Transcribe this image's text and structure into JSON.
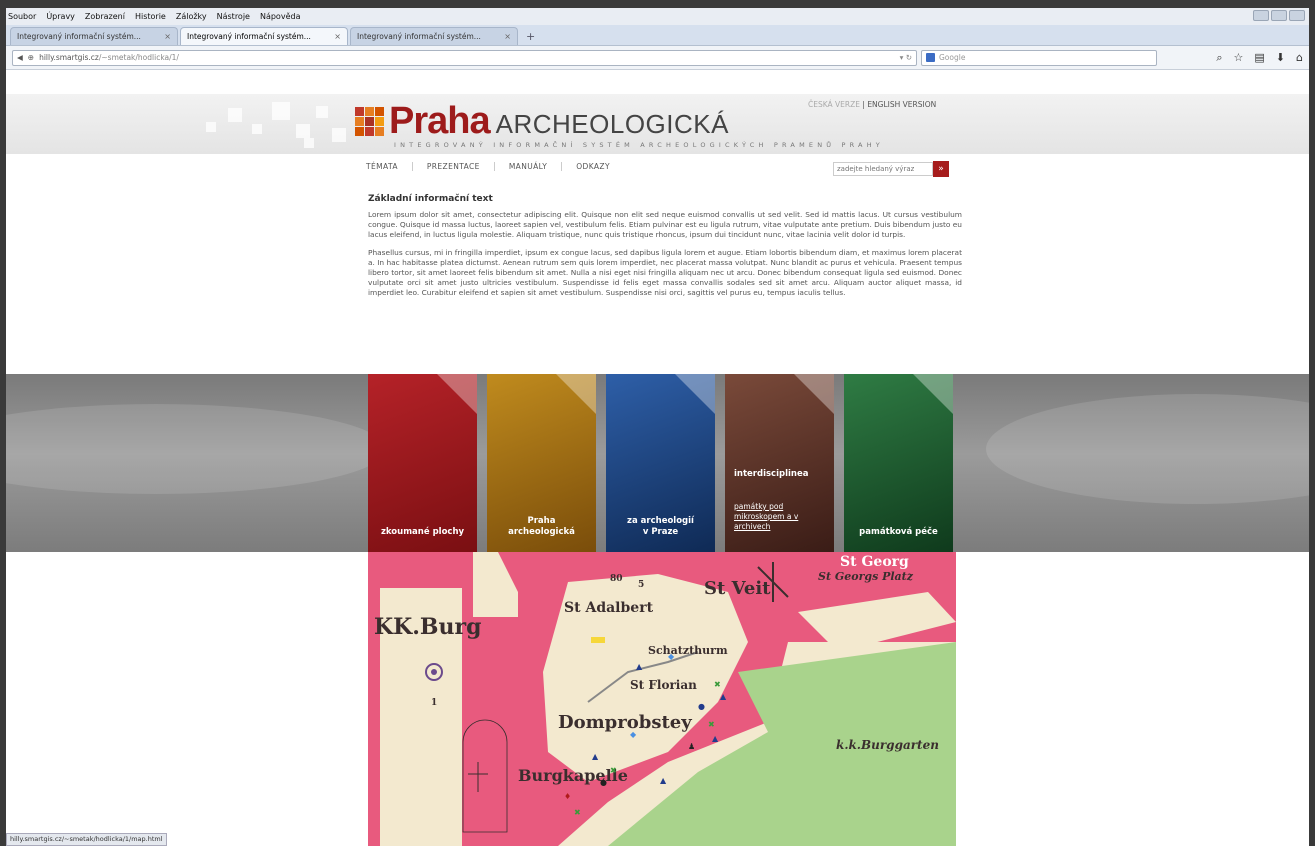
{
  "browser": {
    "menu": [
      "Soubor",
      "Úpravy",
      "Zobrazení",
      "Historie",
      "Záložky",
      "Nástroje",
      "Nápověda"
    ],
    "tabs": [
      {
        "label": "Integrovaný informační systém..."
      },
      {
        "label": "Integrovaný informační systém..."
      },
      {
        "label": "Integrovaný informační systém..."
      }
    ],
    "new_tab": "+",
    "url_host": "hilly.smartgis.cz",
    "url_path": "/~smetak/hodlicka/1/",
    "search_placeholder": "Google",
    "status_url": "hilly.smartgis.cz/~smetak/hodlicka/1/map.html"
  },
  "site": {
    "logo_praha": "Praha",
    "logo_arch": "ARCHEOLOGICKÁ",
    "tagline": "INTEGROVANÝ INFORMAČNÍ SYSTÉM ARCHEOLOGICKÝCH PRAMENŮ PRAHY",
    "lang_cz": "ČESKÁ VERZE",
    "lang_sep": "|",
    "lang_en": "ENGLISH VERSION",
    "nav": [
      "TÉMATA",
      "PREZENTACE",
      "MANUÁLY",
      "ODKAZY"
    ],
    "search_placeholder": "zadejte hledaný výraz",
    "search_go": "»"
  },
  "content": {
    "heading": "Základní informační text",
    "para1": "Lorem ipsum dolor sit amet, consectetur adipiscing elit. Quisque non elit sed neque euismod convallis ut sed velit. Sed id mattis lacus. Ut cursus vestibulum congue. Quisque id massa luctus, laoreet sapien vel, vestibulum felis. Etiam pulvinar est eu ligula rutrum, vitae vulputate ante pretium. Duis bibendum justo eu lacus eleifend, in luctus ligula molestie. Aliquam tristique, nunc quis tristique rhoncus, ipsum dui tincidunt nunc, vitae lacinia velit dolor id turpis.",
    "para2": "Phasellus cursus, mi in fringilla imperdiet, ipsum ex congue lacus, sed dapibus ligula lorem et augue. Etiam lobortis bibendum diam, et maximus lorem placerat a. In hac habitasse platea dictumst. Aenean rutrum sem quis lorem imperdiet, nec placerat massa volutpat. Nunc blandit ac purus et vehicula. Praesent tempus libero tortor, sit amet laoreet felis bibendum sit amet. Nulla a nisi eget nisi fringilla aliquam nec ut arcu. Donec bibendum consequat ligula sed euismod. Donec vulputate orci sit amet justo ultricies vestibulum. Suspendisse id felis eget massa convallis sodales sed sit amet arcu. Aliquam auctor aliquet massa, id imperdiet leo. Curabitur eleifend et sapien sit amet vestibulum. Suspendisse nisi orci, sagittis vel purus eu, tempus iaculis tellus."
  },
  "tiles": [
    {
      "label": "zkoumané plochy",
      "color": "#8e1518"
    },
    {
      "label": "Praha archeologická",
      "color": "#9a6a12"
    },
    {
      "label": "za archeologií v Praze",
      "color": "#1a3f7a"
    },
    {
      "title": "interdisciplinea",
      "link": "památky pod mikroskopem a v archivech",
      "color": "#5a2a22"
    },
    {
      "label": "památková péče",
      "color": "#1d5a2e"
    }
  ],
  "map": {
    "labels": [
      "KK.Burg",
      "St Adalbert",
      "St Veit",
      "St Georgs Platz",
      "Schatzthurm",
      "St Florian",
      "Domprobstey",
      "Burgkapelle",
      "k.k.Burggarten",
      "St Georg"
    ],
    "numbers": [
      "1",
      "80",
      "5"
    ]
  }
}
